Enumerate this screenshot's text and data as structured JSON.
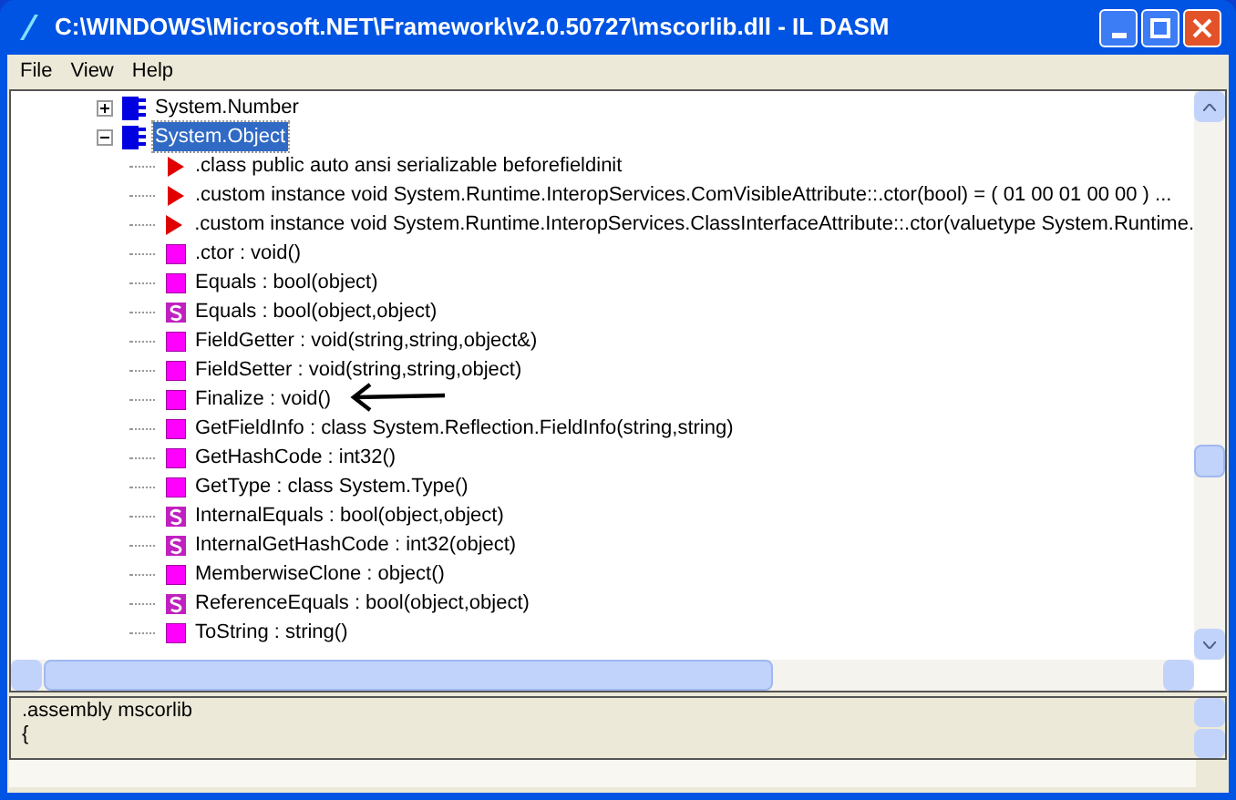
{
  "window": {
    "title": "C:\\WINDOWS\\Microsoft.NET\\Framework\\v2.0.50727\\mscorlib.dll - IL DASM"
  },
  "menu": [
    "File",
    "View",
    "Help"
  ],
  "tree": [
    {
      "label": "System.Number",
      "kind": "class",
      "expanded": false,
      "selected": false
    },
    {
      "label": "System.Object",
      "kind": "class",
      "expanded": true,
      "selected": true,
      "children": [
        {
          "label": ".class public auto ansi serializable beforefieldinit",
          "kind": "attribute"
        },
        {
          "label": ".custom instance void System.Runtime.InteropServices.ComVisibleAttribute::.ctor(bool) = ( 01 00 01 00 00 )  ...",
          "kind": "attribute"
        },
        {
          "label": ".custom instance void System.Runtime.InteropServices.ClassInterfaceAttribute::.ctor(valuetype System.Runtime.",
          "kind": "attribute"
        },
        {
          "label": ".ctor : void()",
          "kind": "method"
        },
        {
          "label": "Equals : bool(object)",
          "kind": "method"
        },
        {
          "label": "Equals : bool(object,object)",
          "kind": "static"
        },
        {
          "label": "FieldGetter : void(string,string,object&)",
          "kind": "method"
        },
        {
          "label": "FieldSetter : void(string,string,object)",
          "kind": "method"
        },
        {
          "label": "Finalize : void()",
          "kind": "method"
        },
        {
          "label": "GetFieldInfo : class System.Reflection.FieldInfo(string,string)",
          "kind": "method"
        },
        {
          "label": "GetHashCode : int32()",
          "kind": "method"
        },
        {
          "label": "GetType : class System.Type()",
          "kind": "method"
        },
        {
          "label": "InternalEquals : bool(object,object)",
          "kind": "static"
        },
        {
          "label": "InternalGetHashCode : int32(object)",
          "kind": "static"
        },
        {
          "label": "MemberwiseClone : object()",
          "kind": "method"
        },
        {
          "label": "ReferenceEquals : bool(object,object)",
          "kind": "static"
        },
        {
          "label": "ToString : string()",
          "kind": "method"
        }
      ]
    }
  ],
  "output": [
    ".assembly mscorlib",
    "{"
  ]
}
